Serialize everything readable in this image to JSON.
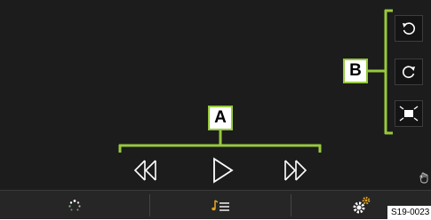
{
  "callouts": {
    "a_label": "A",
    "b_label": "B"
  },
  "side_buttons": [
    {
      "name": "rotate-left",
      "icon": "rotate-ccw-icon"
    },
    {
      "name": "rotate-right",
      "icon": "rotate-cw-icon"
    },
    {
      "name": "fit-screen",
      "icon": "fit-screen-icon"
    }
  ],
  "media_controls": [
    {
      "name": "previous",
      "icon": "previous-icon"
    },
    {
      "name": "play",
      "icon": "play-icon"
    },
    {
      "name": "next",
      "icon": "next-icon"
    }
  ],
  "bottom_bar": [
    {
      "name": "home",
      "icon": "loading-dots-icon"
    },
    {
      "name": "playlist",
      "icon": "playlist-icon"
    },
    {
      "name": "settings",
      "icon": "gear-icon"
    }
  ],
  "figure_code": "S19-0023",
  "colors": {
    "background": "#1c1c1c",
    "callout_green": "#97c93d",
    "icon_white": "#ffffff",
    "accent_gold": "#e0a020"
  }
}
